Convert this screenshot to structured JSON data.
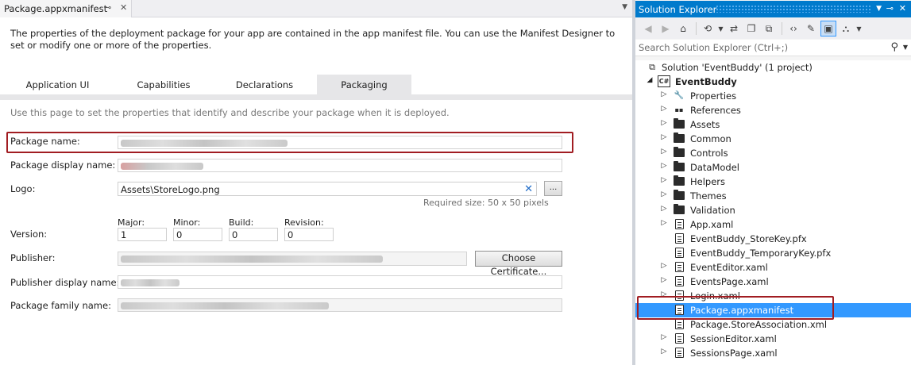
{
  "document": {
    "tab_title": "Package.appxmanifest",
    "pin_glyph": "⊸",
    "close_glyph": "✕",
    "intro": "The properties of the deployment package for your app are contained in the app manifest file. You can use the Manifest Designer to set or modify one or more of the properties.",
    "tabs": [
      "Application UI",
      "Capabilities",
      "Declarations",
      "Packaging"
    ],
    "active_tab": "Packaging",
    "page_description": "Use this page to set the properties that identify and describe your package when it is deployed.",
    "fields": {
      "package_name_label": "Package name:",
      "package_display_name_label": "Package display name:",
      "logo_label": "Logo:",
      "logo_value": "Assets\\StoreLogo.png",
      "logo_browse_label": "...",
      "logo_hint": "Required size: 50 x 50 pixels",
      "version_label": "Version:",
      "version_parts": [
        {
          "label": "Major:",
          "value": "1"
        },
        {
          "label": "Minor:",
          "value": "0"
        },
        {
          "label": "Build:",
          "value": "0"
        },
        {
          "label": "Revision:",
          "value": "0"
        }
      ],
      "publisher_label": "Publisher:",
      "choose_certificate_label": "Choose Certificate...",
      "publisher_display_name_label": "Publisher display name:",
      "package_family_name_label": "Package family name:"
    }
  },
  "solution_explorer": {
    "title": "Solution Explorer",
    "search_placeholder": "Search Solution Explorer (Ctrl+;)",
    "toolbar_icons": [
      "back-icon",
      "forward-icon",
      "home-icon",
      "history-icon",
      "sync-icon",
      "collapse-all-icon",
      "show-all-files-icon",
      "view-code-icon",
      "properties-icon",
      "preview-icon",
      "class-view-icon"
    ],
    "tree": [
      {
        "label": "Solution 'EventBuddy' (1 project)",
        "icon": "solution-icon",
        "expander": "",
        "level": 0
      },
      {
        "label": "EventBuddy",
        "icon": "csharp-project-icon",
        "expander": "◢",
        "level": 1,
        "bold": true
      },
      {
        "label": "Properties",
        "icon": "wrench-icon",
        "expander": "▷",
        "level": 2
      },
      {
        "label": "References",
        "icon": "references-icon",
        "expander": "▷",
        "level": 2
      },
      {
        "label": "Assets",
        "icon": "folder-icon",
        "expander": "▷",
        "level": 2
      },
      {
        "label": "Common",
        "icon": "folder-icon",
        "expander": "▷",
        "level": 2
      },
      {
        "label": "Controls",
        "icon": "folder-icon",
        "expander": "▷",
        "level": 2
      },
      {
        "label": "DataModel",
        "icon": "folder-icon",
        "expander": "▷",
        "level": 2
      },
      {
        "label": "Helpers",
        "icon": "folder-icon",
        "expander": "▷",
        "level": 2
      },
      {
        "label": "Themes",
        "icon": "folder-icon",
        "expander": "▷",
        "level": 2
      },
      {
        "label": "Validation",
        "icon": "folder-icon",
        "expander": "▷",
        "level": 2
      },
      {
        "label": "App.xaml",
        "icon": "xaml-file-icon",
        "expander": "▷",
        "level": 2
      },
      {
        "label": "EventBuddy_StoreKey.pfx",
        "icon": "certificate-file-icon",
        "expander": "",
        "level": 2
      },
      {
        "label": "EventBuddy_TemporaryKey.pfx",
        "icon": "certificate-file-icon",
        "expander": "",
        "level": 2
      },
      {
        "label": "EventEditor.xaml",
        "icon": "xaml-file-icon",
        "expander": "▷",
        "level": 2
      },
      {
        "label": "EventsPage.xaml",
        "icon": "xaml-file-icon",
        "expander": "▷",
        "level": 2
      },
      {
        "label": "Login.xaml",
        "icon": "xaml-file-icon",
        "expander": "▷",
        "level": 2
      },
      {
        "label": "Package.appxmanifest",
        "icon": "manifest-file-icon",
        "expander": "",
        "level": 2,
        "selected": true
      },
      {
        "label": "Package.StoreAssociation.xml",
        "icon": "xml-file-icon",
        "expander": "",
        "level": 2
      },
      {
        "label": "SessionEditor.xaml",
        "icon": "xaml-file-icon",
        "expander": "▷",
        "level": 2
      },
      {
        "label": "SessionsPage.xaml",
        "icon": "xaml-file-icon",
        "expander": "▷",
        "level": 2
      }
    ]
  },
  "colors": {
    "accent": "#007acc",
    "selection": "#3399ff",
    "highlight_box": "#a11d22"
  }
}
